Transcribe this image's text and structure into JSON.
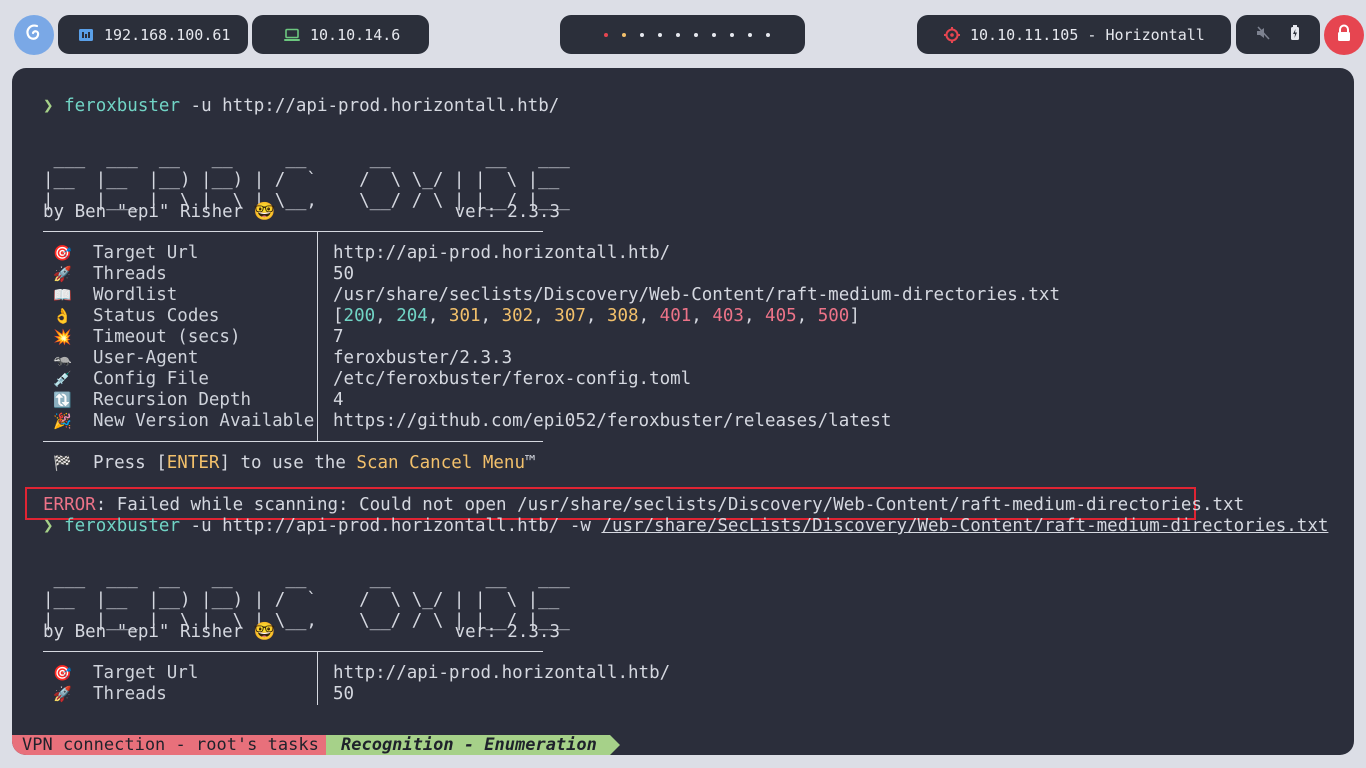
{
  "topbar": {
    "ip_local": "192.168.100.61",
    "ip_vpn": "10.10.14.6",
    "target": "10.10.11.105 - Horizontall",
    "workspace_count": 10
  },
  "prompt_symbol": "❯",
  "cmd1": {
    "bin": "feroxbuster",
    "args": " -u http://api-prod.horizontall.htb/"
  },
  "banner": [
    " ___  ___  __   __     __      __         __   ___",
    "|__  |__  |__) |__) | /  `    /  \\ \\_/ | |  \\ |__",
    "|    |___ |  \\ |  \\ | \\__,    \\__/ / \\ | |__/ |___"
  ],
  "byline": "by Ben \"epi\" Risher 🤓                 ver: 2.3.3",
  "config": [
    {
      "emoji": "🎯",
      "key": "Target Url",
      "value": "http://api-prod.horizontall.htb/"
    },
    {
      "emoji": "🚀",
      "key": "Threads",
      "value": "50"
    },
    {
      "emoji": "📖",
      "key": "Wordlist",
      "value": "/usr/share/seclists/Discovery/Web-Content/raft-medium-directories.txt"
    },
    {
      "emoji": "👌",
      "key": "Status Codes",
      "value": ""
    },
    {
      "emoji": "💥",
      "key": "Timeout (secs)",
      "value": "7"
    },
    {
      "emoji": "🦡",
      "key": "User-Agent",
      "value": "feroxbuster/2.3.3"
    },
    {
      "emoji": "💉",
      "key": "Config File",
      "value": "/etc/feroxbuster/ferox-config.toml"
    },
    {
      "emoji": "🔃",
      "key": "Recursion Depth",
      "value": "4"
    },
    {
      "emoji": "🎉",
      "key": "New Version Available",
      "value": "https://github.com/epi052/feroxbuster/releases/latest"
    }
  ],
  "status_codes": {
    "open": "[",
    "close": "]",
    "sep": ", ",
    "codes": [
      {
        "code": "200",
        "color": "#71d4c5"
      },
      {
        "code": "204",
        "color": "#71d4c5"
      },
      {
        "code": "301",
        "color": "#f2c06b"
      },
      {
        "code": "302",
        "color": "#f2c06b"
      },
      {
        "code": "307",
        "color": "#f2c06b"
      },
      {
        "code": "308",
        "color": "#f2c06b"
      },
      {
        "code": "401",
        "color": "#ed7388"
      },
      {
        "code": "403",
        "color": "#ed7388"
      },
      {
        "code": "405",
        "color": "#ed7388"
      },
      {
        "code": "500",
        "color": "#ed7388"
      }
    ]
  },
  "press": {
    "emoji": "🏁",
    "pre": "Press [",
    "enter": "ENTER",
    "mid": "] to use the ",
    "menu": "Scan Cancel Menu",
    "tm": "™"
  },
  "error": {
    "label": "ERROR",
    "message": ": Failed while scanning: Could not open /usr/share/seclists/Discovery/Web-Content/raft-medium-directories.txt"
  },
  "cmd2": {
    "bin": "feroxbuster",
    "args": " -u http://api-prod.horizontall.htb/ -w ",
    "path": "/usr/share/SecLists/Discovery/Web-Content/raft-medium-directories.txt"
  },
  "statusbar": {
    "left": "VPN connection - root's tasks",
    "right": "Recognition - Enumeration"
  },
  "colors": {
    "terminal_bg": "#2b2e3b",
    "prompt": "#a6d189",
    "command": "#71d4c5",
    "error_border": "#e02433",
    "status_left": "#e8707b",
    "status_right": "#a6d189"
  }
}
